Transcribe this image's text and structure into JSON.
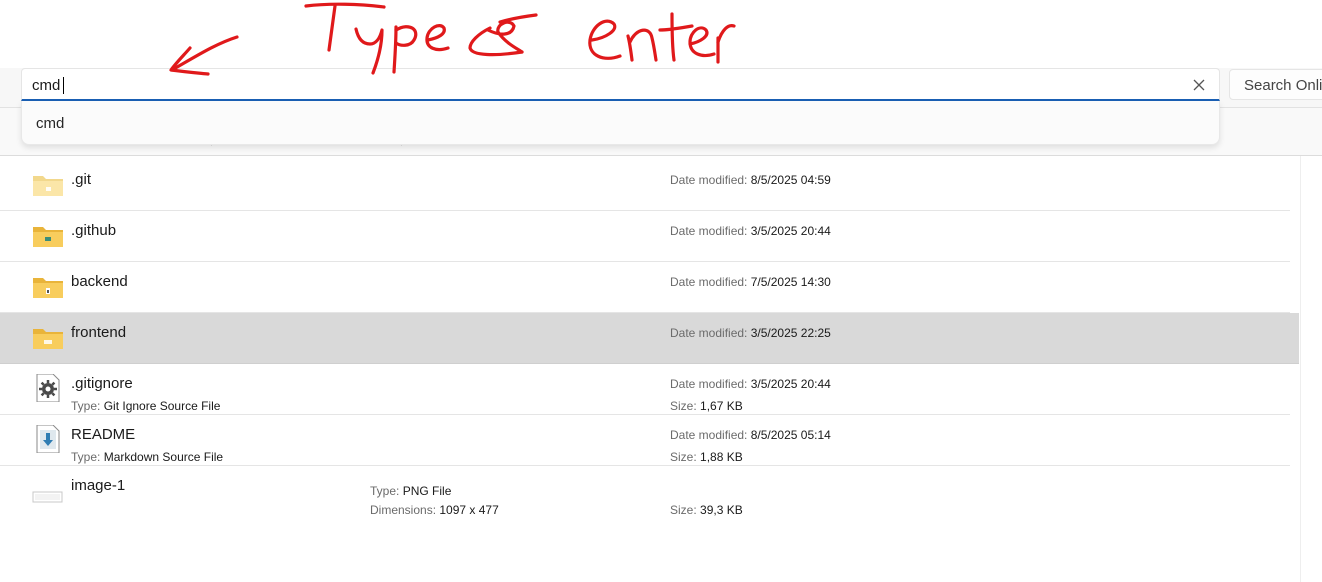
{
  "annotation": {
    "text": "Type & enter",
    "color": "#e0191b"
  },
  "address_bar": {
    "value": "cmd",
    "placeholder": ""
  },
  "suggestions": [
    "cmd"
  ],
  "search": {
    "placeholder": "Search Online"
  },
  "labels": {
    "date_modified": "Date modified:",
    "type": "Type:",
    "size": "Size:",
    "dimensions": "Dimensions:"
  },
  "files": [
    {
      "name": ".git",
      "icon": "folder-icon",
      "date": "8/5/2025 04:59"
    },
    {
      "name": ".github",
      "icon": "folder-icon",
      "date": "3/5/2025 20:44"
    },
    {
      "name": "backend",
      "icon": "folder-icon",
      "date": "7/5/2025 14:30"
    },
    {
      "name": "frontend",
      "icon": "folder-icon",
      "date": "3/5/2025 22:25",
      "selected": true
    },
    {
      "name": ".gitignore",
      "icon": "settings-file-icon",
      "type": "Git Ignore Source File",
      "date": "3/5/2025 20:44",
      "size": "1,67 KB"
    },
    {
      "name": "README",
      "icon": "markdown-file-icon",
      "type": "Markdown Source File",
      "date": "8/5/2025 05:14",
      "size": "1,88 KB"
    },
    {
      "name": "image-1",
      "icon": "image-file-icon",
      "type": "PNG File",
      "dimensions": "1097 x 477",
      "size": "39,3 KB"
    }
  ],
  "colors": {
    "accent": "#1a5fb4",
    "selected_row": "#d9d9d9",
    "folder": "#f6c659"
  }
}
